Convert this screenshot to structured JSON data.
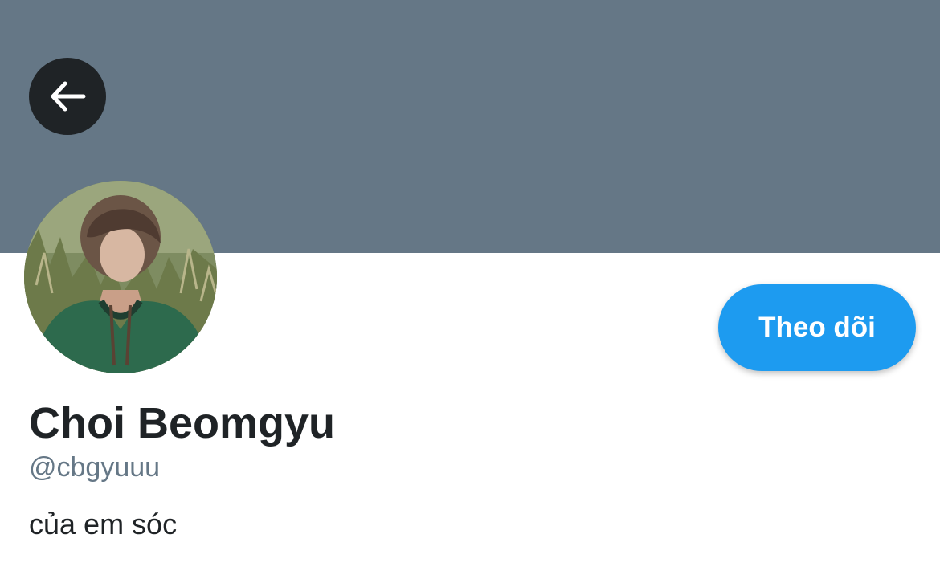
{
  "header": {
    "back_icon": "arrow-left-icon",
    "banner_color": "#657786"
  },
  "profile": {
    "display_name": "Choi Beomgyu",
    "handle": "@cbgyuuu",
    "bio": "của em sóc",
    "follow_label": "Theo dõi",
    "accent_color": "#1d9bf0"
  }
}
